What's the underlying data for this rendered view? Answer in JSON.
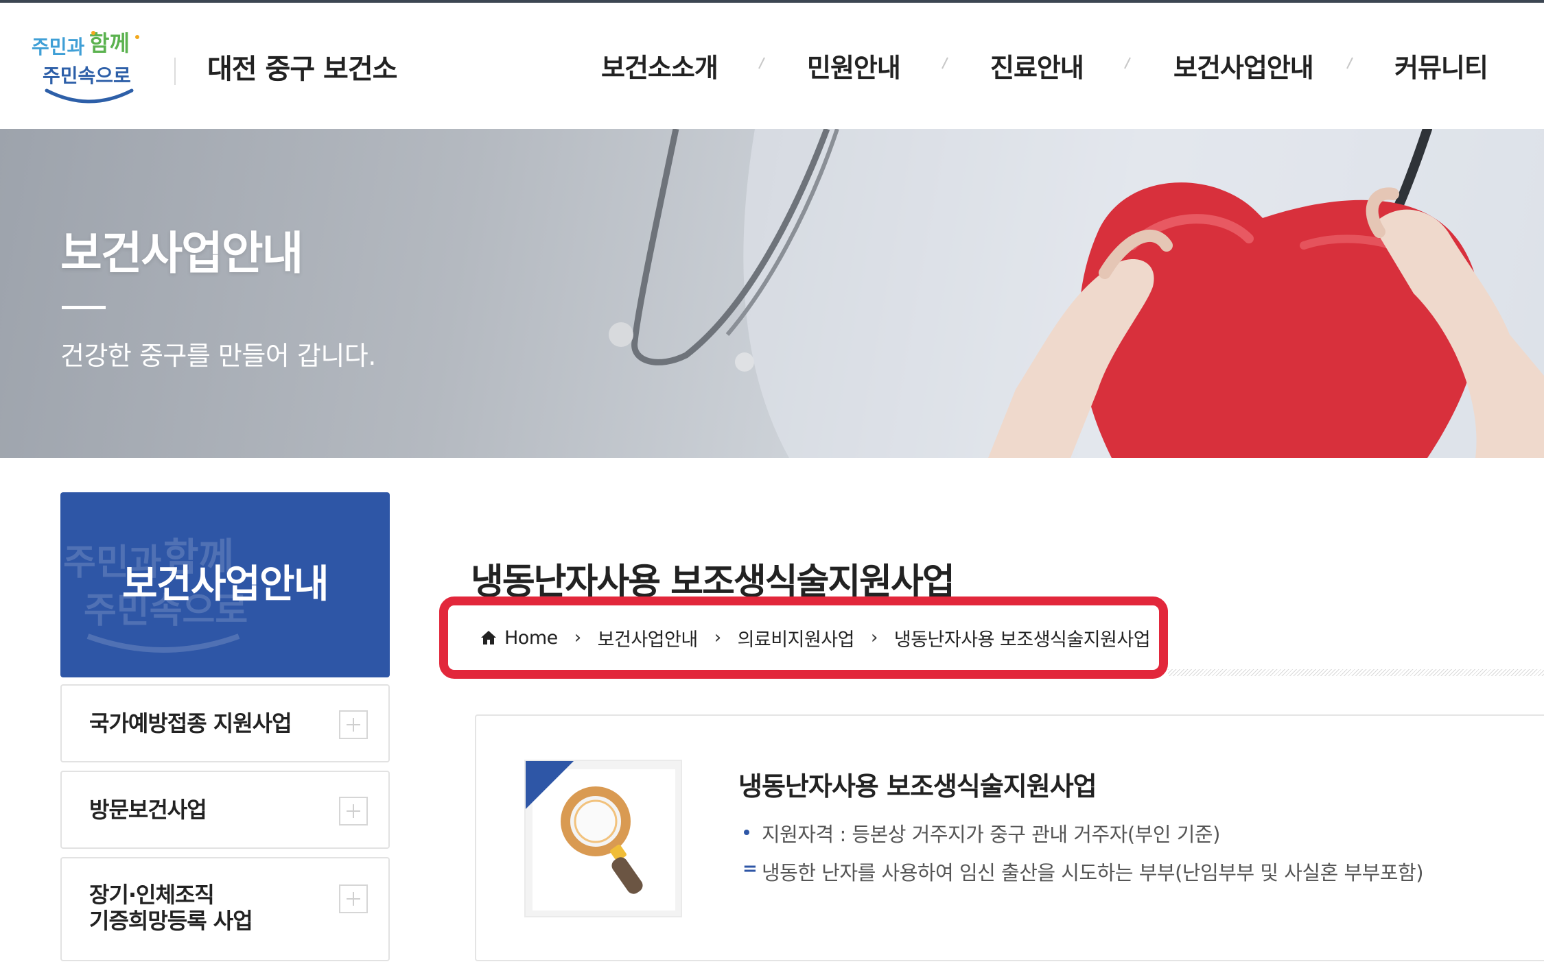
{
  "header": {
    "logo_alt": "주민과 함께 주민속으로",
    "logo_line1_a": "주민과",
    "logo_line1_b": "함께",
    "logo_line2": "주민속으로",
    "site_title": "대전 중구 보건소",
    "nav": [
      {
        "label": "보건소소개"
      },
      {
        "label": "민원안내"
      },
      {
        "label": "진료안내"
      },
      {
        "label": "보건사업안내"
      },
      {
        "label": "커뮤니티"
      }
    ]
  },
  "hero": {
    "title": "보건사업안내",
    "subtitle": "건강한 중구를 만들어 갑니다."
  },
  "side": {
    "title": "보건사업안내",
    "items": [
      {
        "label": "국가예방접종 지원사업"
      },
      {
        "label": "방문보건사업"
      },
      {
        "label": "장기·인체조직\n기증희망등록 사업"
      }
    ]
  },
  "content": {
    "page_title": "냉동난자사용 보조생식술지원사업",
    "breadcrumb": [
      {
        "label": "Home"
      },
      {
        "label": "보건사업안내"
      },
      {
        "label": "의료비지원사업"
      },
      {
        "label": "냉동난자사용 보조생식술지원사업"
      }
    ],
    "breadcrumb_sep": "›",
    "card": {
      "title": "냉동난자사용 보조생식술지원사업",
      "lines": [
        "지원자격 : 등본상 거주지가 중구 관내 거주자(부인 기준)",
        "냉동한 난자를 사용하여 임신 출산을 시도하는 부부(난임부부 및 사실혼 부부포함)"
      ],
      "bullet2_mark": "="
    }
  },
  "colors": {
    "brand_blue": "#2e56a6",
    "highlight_red": "#e2273b",
    "topline": "#3c4652"
  },
  "icons": {
    "home": "home-icon",
    "plus": "plus-icon",
    "magnifier": "magnifier-icon"
  }
}
